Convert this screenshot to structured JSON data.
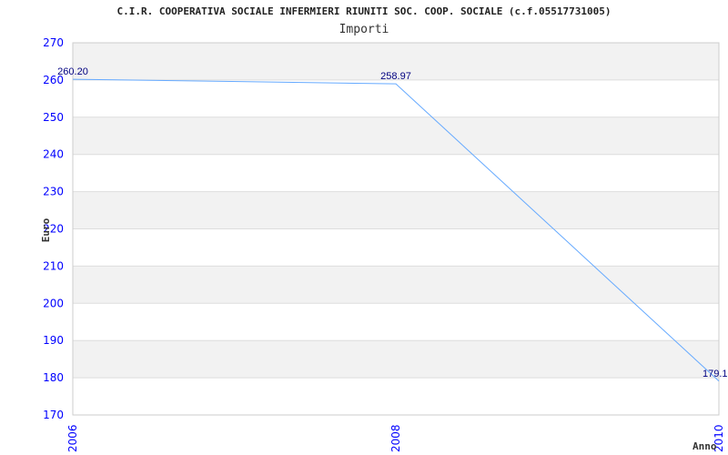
{
  "chart_data": {
    "type": "line",
    "title": "C.I.R. COOPERATIVA SOCIALE INFERMIERI RIUNITI SOC. COOP. SOCIALE (c.f.05517731005)",
    "subtitle": "Importi",
    "xlabel": "Anno",
    "ylabel": "Euro",
    "x": [
      "2006",
      "2008",
      "2010"
    ],
    "series": [
      {
        "values": [
          260.2,
          258.97,
          179.1
        ]
      }
    ],
    "ylim": [
      170,
      270
    ],
    "yticks": [
      170,
      180,
      190,
      200,
      210,
      220,
      230,
      240,
      250,
      260,
      270
    ],
    "grid": true,
    "colors": {
      "line": "#66aaff",
      "label": "#000080",
      "tick": "#0000ff",
      "band": "#f2f2f2",
      "grid": "#dddddd"
    }
  }
}
